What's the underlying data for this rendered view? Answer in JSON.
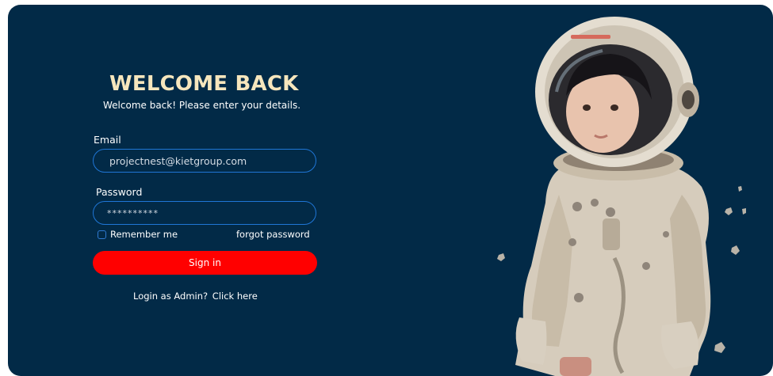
{
  "login": {
    "title": "WELCOME BACK",
    "subtitle": "Welcome back! Please enter your details.",
    "email_label": "Email",
    "email_value": "projectnest@kietgroup.com",
    "password_label": "Password",
    "password_value": "**********",
    "remember_label": "Remember me",
    "remember_checked": false,
    "forgot_label": "forgot password",
    "signin_label": "Sign in",
    "admin_prompt": "Login as Admin?",
    "admin_link": "Click here"
  },
  "colors": {
    "background": "#022a47",
    "title": "#f6e6bd",
    "input_border": "#1f76d6",
    "signin_button": "#ff0000"
  },
  "illustration": {
    "icon": "astronaut-illustration"
  }
}
